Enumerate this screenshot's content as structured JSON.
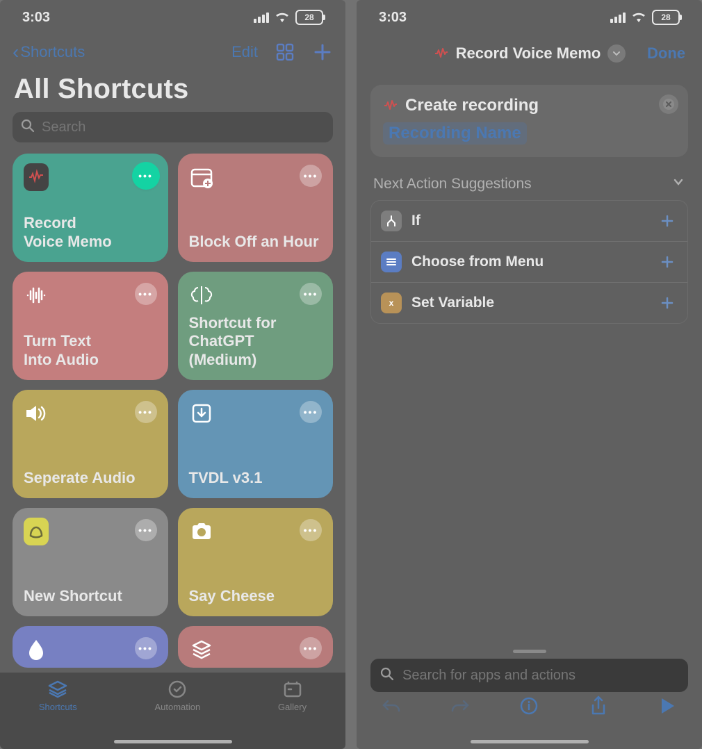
{
  "status": {
    "time": "3:03",
    "battery": "28"
  },
  "left": {
    "nav": {
      "back": "Shortcuts",
      "edit": "Edit"
    },
    "title": "All Shortcuts",
    "search_placeholder": "Search",
    "cards": [
      {
        "label": "Record\nVoice Memo",
        "color": "teal",
        "icon": "waveform-icon",
        "highlighted": true
      },
      {
        "label": "Block Off an Hour",
        "color": "pink",
        "icon": "calendar-add-icon"
      },
      {
        "label": "Turn Text\nInto Audio",
        "color": "pink2",
        "icon": "sound-wave-icon"
      },
      {
        "label": "Shortcut for ChatGPT (Medium)",
        "color": "green",
        "icon": "brain-icon"
      },
      {
        "label": "Seperate Audio",
        "color": "yellow",
        "icon": "speaker-icon"
      },
      {
        "label": "TVDL v3.1",
        "color": "blue",
        "icon": "download-icon"
      },
      {
        "label": "New Shortcut",
        "color": "gray",
        "icon": "basecamp-icon"
      },
      {
        "label": "Say Cheese",
        "color": "yellow",
        "icon": "camera-icon"
      },
      {
        "label": "",
        "color": "purple",
        "icon": "drop-icon"
      },
      {
        "label": "",
        "color": "pink",
        "icon": "layers-icon"
      }
    ],
    "tabs": [
      {
        "label": "Shortcuts",
        "icon": "shortcuts-stack-icon",
        "active": true
      },
      {
        "label": "Automation",
        "icon": "clock-check-icon"
      },
      {
        "label": "Gallery",
        "icon": "cards-icon"
      }
    ]
  },
  "right": {
    "title": "Record Voice Memo",
    "done": "Done",
    "action": {
      "verb": "Create recording",
      "token": "Recording Name"
    },
    "suggestions_header": "Next Action Suggestions",
    "suggestions": [
      {
        "label": "If",
        "icon": "branch-icon",
        "color": "#7e7e7e"
      },
      {
        "label": "Choose from Menu",
        "icon": "menu-icon",
        "color": "#5b7dc3"
      },
      {
        "label": "Set Variable",
        "icon": "variable-icon",
        "color": "#b89258"
      }
    ],
    "search_placeholder": "Search for apps and actions",
    "toolbar": [
      "undo-icon",
      "redo-icon",
      "info-icon",
      "share-icon",
      "play-icon"
    ]
  }
}
